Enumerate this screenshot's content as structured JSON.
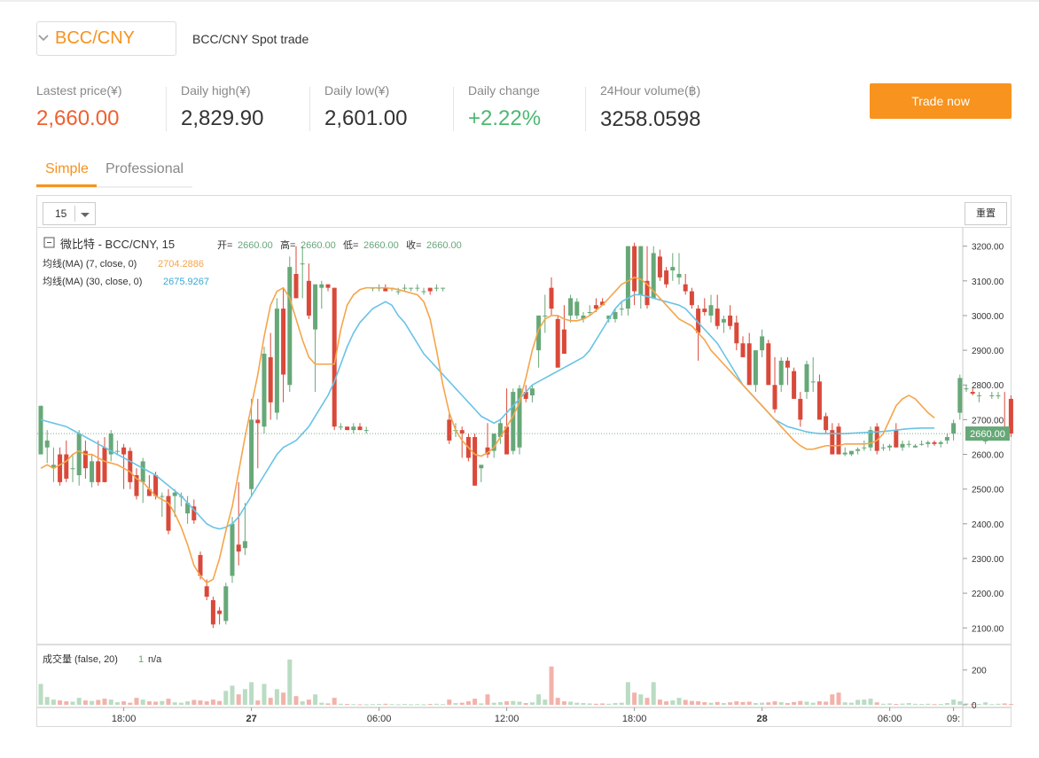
{
  "header": {
    "pair_label": "BCC/CNY",
    "subtitle": "BCC/CNY Spot trade",
    "dropdown_icon": "chevron-down-icon"
  },
  "stats": [
    {
      "label": "Lastest price(¥)",
      "value": "2,660.00",
      "color": "#f0602f"
    },
    {
      "label": "Daily high(¥)",
      "value": "2,829.90",
      "color": "#333333"
    },
    {
      "label": "Daily low(¥)",
      "value": "2,601.00",
      "color": "#333333"
    },
    {
      "label": "Daily change",
      "value": "+2.22%",
      "color": "#4db872"
    },
    {
      "label": "24Hour volume(฿)",
      "value": "3258.0598",
      "color": "#333333"
    }
  ],
  "trade_button": "Trade now",
  "tabs": [
    {
      "label": "Simple",
      "active": true
    },
    {
      "label": "Professional",
      "active": false
    }
  ],
  "toolbar": {
    "interval": "15",
    "reset_label": "重置"
  },
  "legend": {
    "title": "微比特 - BCC/CNY, 15",
    "open_label": "开=",
    "open": "2660.00",
    "high_label": "高=",
    "high": "2660.00",
    "low_label": "低=",
    "low": "2660.00",
    "close_label": "收=",
    "close": "2660.00",
    "ma7_label": "均线(MA) (7, close, 0)",
    "ma7_value": "2704.2886",
    "ma30_label": "均线(MA) (30, close, 0)",
    "ma30_value": "2675.9267",
    "vol_label": "成交量 (false, 20)",
    "vol_value": "1",
    "vol_extra": "n/a"
  },
  "colors": {
    "up": "#67a878",
    "down": "#d9493a",
    "ma7": "#f5a54a",
    "ma30": "#6ac3e6",
    "accent": "#f7931e"
  },
  "chart_data": {
    "type": "candlestick",
    "last_price_label": "2660.00",
    "last_price": 2660,
    "price_axis": {
      "ylim": [
        2070,
        3240
      ],
      "ticks": [
        "3200.00",
        "3100.00",
        "3000.00",
        "2900.00",
        "2800.00",
        "2700.00",
        "2600.00",
        "2500.00",
        "2400.00",
        "2300.00",
        "2200.00",
        "2100.00"
      ]
    },
    "volume_axis": {
      "ylim": [
        0,
        280
      ],
      "ticks": [
        "200",
        "0"
      ]
    },
    "time_axis": {
      "labels": [
        {
          "label": "18:00",
          "i": 13,
          "bold": false
        },
        {
          "label": "27",
          "i": 33,
          "bold": true
        },
        {
          "label": "06:00",
          "i": 53,
          "bold": false
        },
        {
          "label": "12:00",
          "i": 73,
          "bold": false
        },
        {
          "label": "18:00",
          "i": 93,
          "bold": false
        },
        {
          "label": "28",
          "i": 113,
          "bold": true
        },
        {
          "label": "06:00",
          "i": 133,
          "bold": false
        },
        {
          "label": "09:",
          "i": 143,
          "bold": false
        }
      ]
    },
    "candles": [
      [
        2600,
        2740,
        2600,
        2740,
        120
      ],
      [
        2620,
        2670,
        2575,
        2640,
        45
      ],
      [
        2560,
        2620,
        2520,
        2570,
        30
      ],
      [
        2600,
        2620,
        2510,
        2520,
        25
      ],
      [
        2600,
        2640,
        2520,
        2530,
        20
      ],
      [
        2560,
        2600,
        2520,
        2560,
        18
      ],
      [
        2540,
        2670,
        2510,
        2660,
        40
      ],
      [
        2610,
        2640,
        2530,
        2560,
        25
      ],
      [
        2520,
        2600,
        2505,
        2580,
        22
      ],
      [
        2580,
        2640,
        2510,
        2520,
        28
      ],
      [
        2620,
        2650,
        2520,
        2520,
        35
      ],
      [
        2600,
        2670,
        2580,
        2660,
        30
      ],
      [
        2610,
        2640,
        2600,
        2610,
        15
      ],
      [
        2620,
        2630,
        2500,
        2600,
        20
      ],
      [
        2610,
        2620,
        2500,
        2520,
        12
      ],
      [
        2540,
        2560,
        2470,
        2480,
        40
      ],
      [
        2520,
        2590,
        2460,
        2580,
        30
      ],
      [
        2500,
        2540,
        2480,
        2480,
        20
      ],
      [
        2540,
        2550,
        2470,
        2480,
        18
      ],
      [
        2480,
        2490,
        2420,
        2480,
        22
      ],
      [
        2480,
        2500,
        2370,
        2380,
        35
      ],
      [
        2480,
        2500,
        2420,
        2490,
        14
      ],
      [
        2480,
        2490,
        2450,
        2480,
        12
      ],
      [
        2430,
        2480,
        2400,
        2460,
        20
      ],
      [
        2450,
        2470,
        2400,
        2410,
        28
      ],
      [
        2310,
        2320,
        2240,
        2250,
        25
      ],
      [
        2220,
        2240,
        2180,
        2190,
        20
      ],
      [
        2180,
        2190,
        2100,
        2110,
        30
      ],
      [
        2150,
        2160,
        2110,
        2140,
        22
      ],
      [
        2120,
        2230,
        2110,
        2220,
        80
      ],
      [
        2250,
        2420,
        2230,
        2400,
        110
      ],
      [
        2340,
        2520,
        2280,
        2320,
        60
      ],
      [
        2330,
        2460,
        2310,
        2350,
        90
      ],
      [
        2500,
        2760,
        2480,
        2700,
        130
      ],
      [
        2700,
        2760,
        2560,
        2690,
        25
      ],
      [
        2680,
        2910,
        2660,
        2890,
        120
      ],
      [
        2880,
        2950,
        2700,
        2750,
        40
      ],
      [
        2720,
        3050,
        2700,
        3020,
        90
      ],
      [
        3020,
        3080,
        2750,
        2830,
        70
      ],
      [
        2800,
        3170,
        2780,
        3140,
        260
      ],
      [
        3120,
        3200,
        3050,
        3050,
        50
      ],
      [
        3150,
        3200,
        3050,
        3150,
        20
      ],
      [
        3100,
        3150,
        2990,
        3000,
        30
      ],
      [
        2960,
        3090,
        2780,
        3090,
        60
      ],
      [
        3080,
        3100,
        3020,
        3090,
        12
      ],
      [
        3090,
        3090,
        3070,
        3080,
        8
      ],
      [
        3080,
        3080,
        2670,
        2680,
        40
      ],
      [
        2680,
        2690,
        2670,
        2680,
        6
      ],
      [
        2680,
        2680,
        2670,
        2670,
        5
      ],
      [
        2670,
        2690,
        2660,
        2680,
        4
      ],
      [
        2680,
        2690,
        2670,
        2670,
        3
      ],
      [
        2670,
        2680,
        2660,
        2670,
        3
      ],
      [
        3080,
        3080,
        3070,
        3080,
        4
      ],
      [
        3080,
        3090,
        3070,
        3080,
        5
      ],
      [
        3080,
        3090,
        3070,
        3070,
        6
      ],
      [
        3080,
        3080,
        3070,
        3080,
        4
      ],
      [
        3070,
        3080,
        3060,
        3070,
        3
      ],
      [
        3080,
        3090,
        3070,
        3080,
        5
      ],
      [
        3080,
        3080,
        3070,
        3080,
        3
      ],
      [
        3080,
        3090,
        3070,
        3080,
        4
      ],
      [
        3070,
        3080,
        3060,
        3070,
        3
      ],
      [
        3080,
        3080,
        3060,
        3070,
        5
      ],
      [
        3080,
        3090,
        3070,
        3080,
        6
      ],
      [
        3080,
        3080,
        3070,
        3080,
        4
      ],
      [
        2700,
        2720,
        2630,
        2640,
        30
      ],
      [
        2670,
        2690,
        2650,
        2670,
        10
      ],
      [
        2670,
        2680,
        2590,
        2660,
        12
      ],
      [
        2650,
        2660,
        2580,
        2590,
        20
      ],
      [
        2650,
        2660,
        2510,
        2510,
        35
      ],
      [
        2560,
        2570,
        2520,
        2570,
        8
      ],
      [
        2620,
        2690,
        2590,
        2600,
        60
      ],
      [
        2610,
        2660,
        2590,
        2660,
        12
      ],
      [
        2650,
        2700,
        2630,
        2690,
        15
      ],
      [
        2680,
        2790,
        2600,
        2600,
        20
      ],
      [
        2610,
        2790,
        2600,
        2780,
        22
      ],
      [
        2620,
        2800,
        2600,
        2790,
        18
      ],
      [
        2780,
        2800,
        2750,
        2760,
        10
      ],
      [
        2770,
        2800,
        2750,
        2790,
        14
      ],
      [
        2900,
        3000,
        2850,
        3000,
        60
      ],
      [
        3000,
        3060,
        2950,
        3000,
        30
      ],
      [
        3080,
        3110,
        3000,
        3020,
        220
      ],
      [
        2990,
        3000,
        2850,
        2850,
        40
      ],
      [
        2960,
        3030,
        2890,
        2890,
        20
      ],
      [
        3000,
        3060,
        2980,
        3050,
        18
      ],
      [
        3000,
        3050,
        2990,
        3040,
        12
      ],
      [
        2990,
        3010,
        2980,
        3000,
        10
      ],
      [
        3010,
        3030,
        3000,
        3010,
        8
      ],
      [
        3030,
        3050,
        3010,
        3020,
        6
      ],
      [
        3040,
        3050,
        3030,
        3030,
        8
      ],
      [
        2990,
        3000,
        2980,
        3000,
        6
      ],
      [
        2990,
        3020,
        2980,
        3010,
        10
      ],
      [
        3020,
        3040,
        3000,
        3020,
        12
      ],
      [
        3020,
        3200,
        3000,
        3200,
        130
      ],
      [
        3200,
        3210,
        3030,
        3070,
        70
      ],
      [
        3060,
        3200,
        3020,
        3200,
        60
      ],
      [
        3100,
        3200,
        3020,
        3030,
        40
      ],
      [
        3050,
        3200,
        3050,
        3180,
        130
      ],
      [
        3170,
        3190,
        3100,
        3110,
        30
      ],
      [
        3130,
        3140,
        3080,
        3090,
        20
      ],
      [
        3130,
        3180,
        3100,
        3140,
        25
      ],
      [
        3110,
        3180,
        3090,
        3120,
        40
      ],
      [
        3090,
        3120,
        3060,
        3070,
        28
      ],
      [
        3070,
        3080,
        3020,
        3030,
        22
      ],
      [
        3020,
        3030,
        2870,
        2950,
        20
      ],
      [
        3020,
        3050,
        3000,
        3010,
        15
      ],
      [
        3000,
        3060,
        2980,
        3030,
        12
      ],
      [
        3020,
        3060,
        2960,
        2970,
        16
      ],
      [
        2980,
        3000,
        2950,
        2990,
        10
      ],
      [
        3000,
        3030,
        2960,
        2970,
        14
      ],
      [
        2980,
        3000,
        2900,
        2920,
        20
      ],
      [
        2920,
        2940,
        2880,
        2880,
        16
      ],
      [
        2920,
        2950,
        2800,
        2800,
        18
      ],
      [
        2800,
        2900,
        2780,
        2900,
        10
      ],
      [
        2900,
        2960,
        2880,
        2940,
        12
      ],
      [
        2920,
        2930,
        2800,
        2800,
        14
      ],
      [
        2800,
        2880,
        2720,
        2730,
        20
      ],
      [
        2800,
        2880,
        2780,
        2870,
        15
      ],
      [
        2870,
        2880,
        2800,
        2850,
        10
      ],
      [
        2840,
        2850,
        2760,
        2760,
        16
      ],
      [
        2760,
        2780,
        2680,
        2700,
        22
      ],
      [
        2780,
        2870,
        2760,
        2860,
        18
      ],
      [
        2810,
        2880,
        2780,
        2810,
        12
      ],
      [
        2810,
        2830,
        2700,
        2700,
        20
      ],
      [
        2710,
        2720,
        2660,
        2670,
        18
      ],
      [
        2670,
        2690,
        2600,
        2600,
        60
      ],
      [
        2680,
        2690,
        2600,
        2600,
        70
      ],
      [
        2600,
        2620,
        2595,
        2605,
        14
      ],
      [
        2600,
        2610,
        2595,
        2610,
        12
      ],
      [
        2610,
        2620,
        2600,
        2615,
        28
      ],
      [
        2620,
        2640,
        2610,
        2620,
        30
      ],
      [
        2620,
        2680,
        2610,
        2670,
        35
      ],
      [
        2680,
        2690,
        2600,
        2610,
        14
      ],
      [
        2620,
        2630,
        2610,
        2620,
        6
      ],
      [
        2620,
        2630,
        2610,
        2625,
        8
      ],
      [
        2670,
        2690,
        2620,
        2620,
        5
      ],
      [
        2620,
        2640,
        2610,
        2630,
        7
      ],
      [
        2630,
        2640,
        2620,
        2630,
        10
      ],
      [
        2620,
        2630,
        2620,
        2625,
        6
      ],
      [
        2630,
        2640,
        2625,
        2630,
        5
      ],
      [
        2630,
        2640,
        2620,
        2635,
        6
      ],
      [
        2635,
        2640,
        2625,
        2630,
        4
      ],
      [
        2630,
        2640,
        2620,
        2635,
        5
      ],
      [
        2640,
        2660,
        2630,
        2650,
        10
      ],
      [
        2660,
        2700,
        2640,
        2690,
        30
      ],
      [
        2720,
        2830,
        2700,
        2820,
        20
      ],
      [
        2790,
        2800,
        2780,
        2790,
        8
      ],
      [
        2780,
        2790,
        2770,
        2775,
        6
      ],
      [
        2770,
        2780,
        2750,
        2770,
        5
      ],
      [
        2640,
        2650,
        2630,
        2640,
        14
      ],
      [
        2770,
        2780,
        2760,
        2770,
        4
      ],
      [
        2770,
        2780,
        2760,
        2770,
        6
      ],
      [
        2660,
        2780,
        2640,
        2650,
        8
      ],
      [
        2760,
        2770,
        2650,
        2660,
        5
      ]
    ],
    "ma7": [
      2560,
      2570,
      2560,
      2570,
      2580,
      2600,
      2610,
      2600,
      2600,
      2590,
      2580,
      2575,
      2570,
      2560,
      2550,
      2530,
      2520,
      2500,
      2480,
      2470,
      2460,
      2430,
      2390,
      2340,
      2280,
      2250,
      2230,
      2240,
      2300,
      2380,
      2450,
      2550,
      2650,
      2740,
      2830,
      2940,
      3030,
      3070,
      3080,
      3050,
      2990,
      2930,
      2880,
      2860,
      2860,
      2860,
      2860,
      2960,
      3030,
      3060,
      3075,
      3080,
      3080,
      3080,
      3080,
      3078,
      3075,
      3070,
      3065,
      3060,
      3040,
      2990,
      2900,
      2800,
      2720,
      2670,
      2640,
      2620,
      2600,
      2595,
      2605,
      2620,
      2650,
      2680,
      2710,
      2750,
      2820,
      2900,
      2960,
      2990,
      3000,
      3000,
      2990,
      2985,
      2985,
      2990,
      3000,
      3015,
      3030,
      3050,
      3070,
      3090,
      3100,
      3110,
      3105,
      3090,
      3070,
      3050,
      3030,
      3010,
      2990,
      2980,
      2970,
      2950,
      2930,
      2900,
      2880,
      2860,
      2840,
      2820,
      2800,
      2780,
      2760,
      2740,
      2720,
      2700,
      2680,
      2660,
      2640,
      2625,
      2615,
      2615,
      2620,
      2625,
      2625,
      2625,
      2630,
      2630,
      2630,
      2630,
      2632,
      2640,
      2660,
      2700,
      2740,
      2760,
      2770,
      2760,
      2740,
      2720,
      2705
    ],
    "ma30": [
      2700,
      2695,
      2690,
      2685,
      2680,
      2670,
      2660,
      2650,
      2640,
      2630,
      2620,
      2610,
      2600,
      2590,
      2580,
      2570,
      2560,
      2550,
      2540,
      2525,
      2510,
      2495,
      2480,
      2460,
      2440,
      2420,
      2400,
      2390,
      2385,
      2390,
      2400,
      2420,
      2450,
      2480,
      2510,
      2540,
      2570,
      2600,
      2620,
      2630,
      2640,
      2660,
      2680,
      2710,
      2740,
      2770,
      2810,
      2860,
      2910,
      2950,
      2980,
      3000,
      3020,
      3030,
      3040,
      3030,
      3000,
      2980,
      2950,
      2920,
      2890,
      2870,
      2850,
      2830,
      2810,
      2790,
      2770,
      2750,
      2730,
      2710,
      2700,
      2690,
      2700,
      2720,
      2740,
      2760,
      2780,
      2800,
      2810,
      2820,
      2830,
      2840,
      2850,
      2860,
      2870,
      2880,
      2900,
      2930,
      2960,
      2990,
      3020,
      3040,
      3050,
      3060,
      3060,
      3055,
      3050,
      3045,
      3040,
      3035,
      3030,
      3020,
      3000,
      2980,
      2960,
      2940,
      2920,
      2890,
      2860,
      2830,
      2800,
      2780,
      2760,
      2740,
      2720,
      2700,
      2690,
      2680,
      2675,
      2670,
      2665,
      2662,
      2660,
      2660,
      2660,
      2660,
      2660,
      2661,
      2662,
      2663,
      2664,
      2665,
      2666,
      2668,
      2670,
      2672,
      2674,
      2675,
      2676,
      2676,
      2676
    ]
  }
}
